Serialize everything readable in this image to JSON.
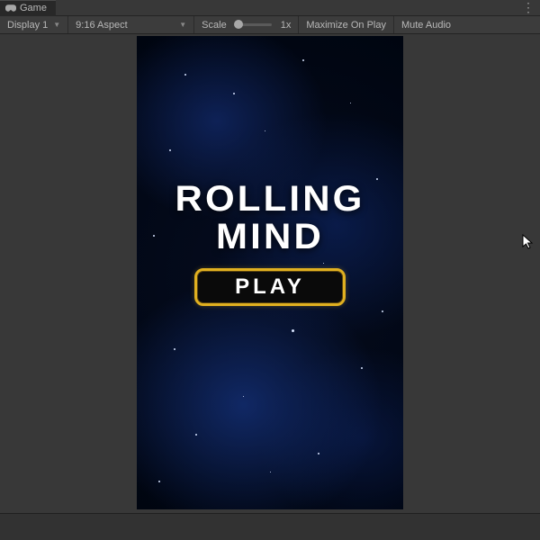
{
  "tab": {
    "label": "Game"
  },
  "toolbar": {
    "display": "Display 1",
    "aspect": "9:16 Aspect",
    "scaleLabel": "Scale",
    "scaleValue": "1x",
    "maximize": "Maximize On Play",
    "muteAudio": "Mute Audio"
  },
  "game": {
    "titleLine1": "ROLLING",
    "titleLine2": "MIND",
    "playLabel": "PLAY"
  },
  "colors": {
    "playBorder": "#e0b020"
  }
}
